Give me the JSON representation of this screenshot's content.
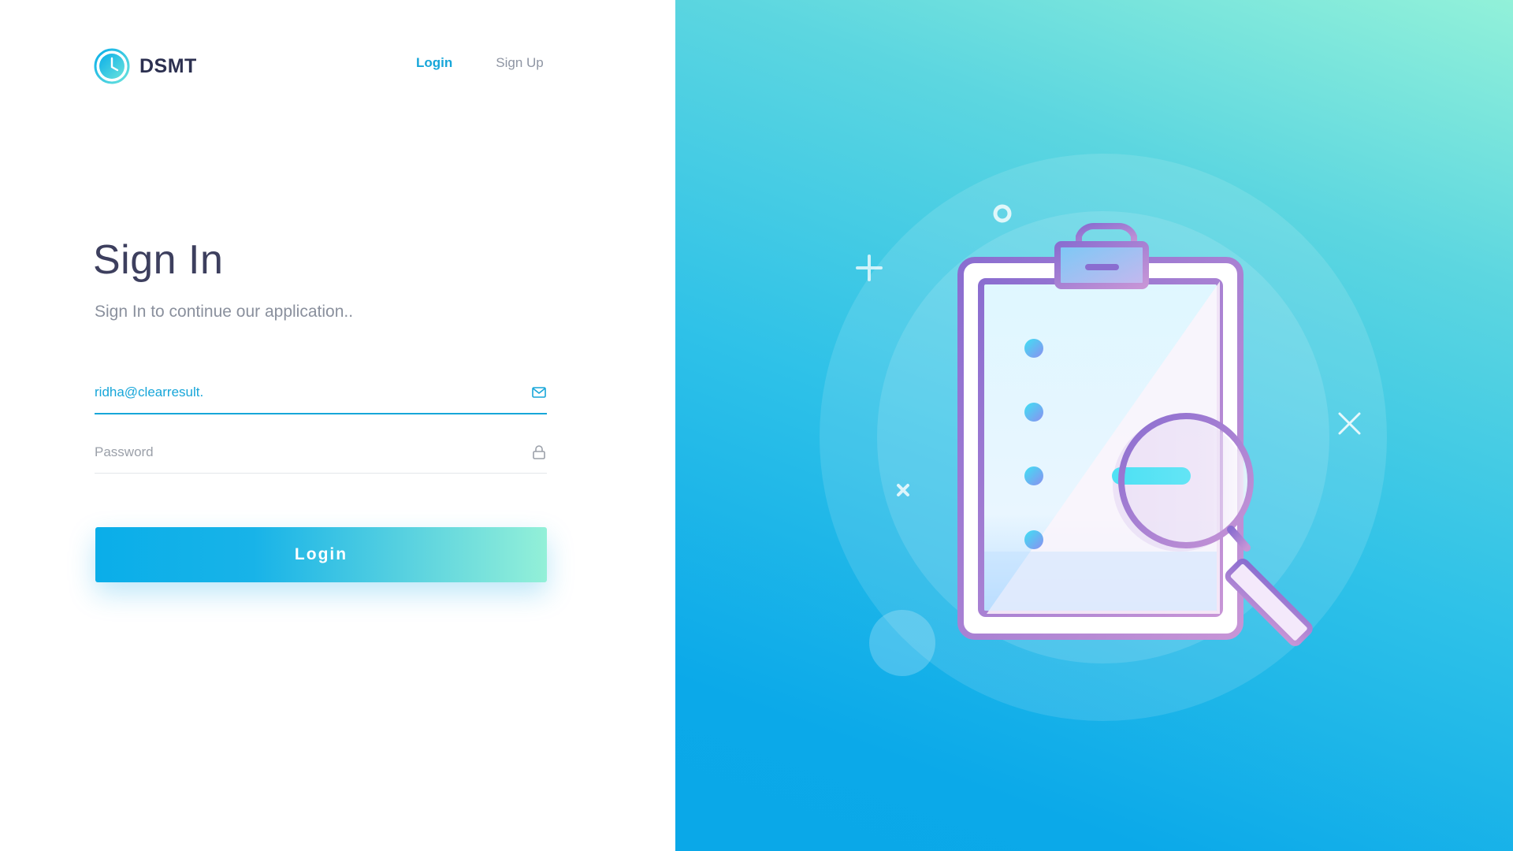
{
  "brand": {
    "name": "DSMT",
    "logo_icon": "clock-icon"
  },
  "nav": {
    "login_label": "Login",
    "signup_label": "Sign Up"
  },
  "form": {
    "title": "Sign In",
    "subtitle": "Sign In to continue our application..",
    "email": {
      "value": "ridha@clearresult.",
      "placeholder": "",
      "icon": "mail-icon"
    },
    "password": {
      "value": "",
      "placeholder": "Password",
      "icon": "lock-icon"
    },
    "submit_label": "Login"
  },
  "colors": {
    "accent": "#17a6d9",
    "title": "#3d3f5e",
    "muted": "#8a909d",
    "gradient_start": "#0aaee9",
    "gradient_end": "#93f0d8",
    "illustration_purple": "#9b6fc8"
  },
  "illustration": {
    "subject": "clipboard-with-magnifier",
    "checklist_items": 4
  }
}
